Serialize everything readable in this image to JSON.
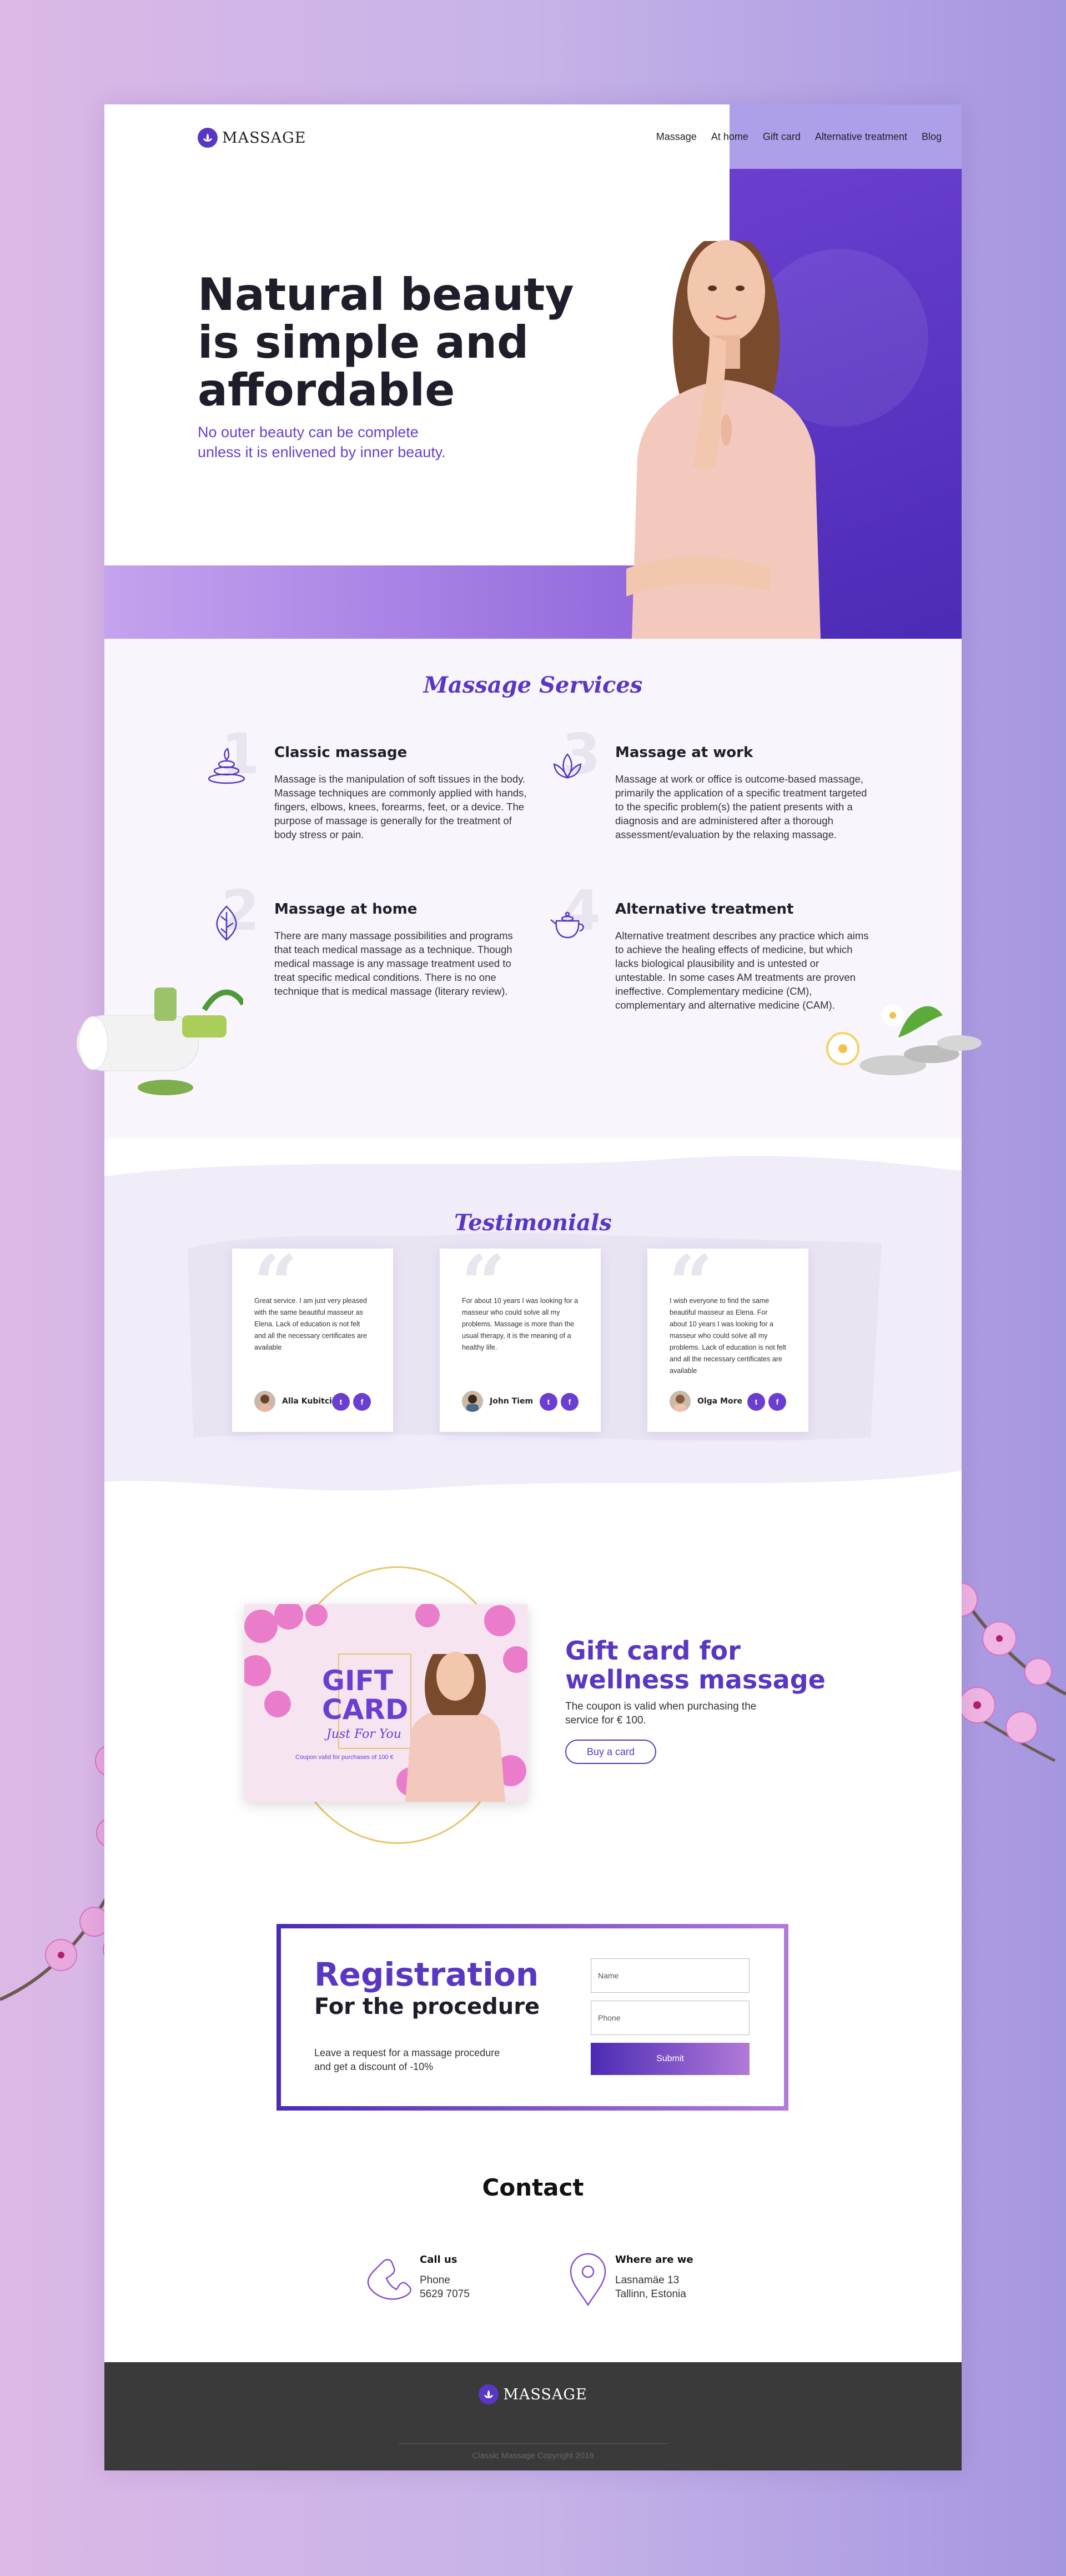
{
  "brand": {
    "name": "MASSAGE"
  },
  "nav": {
    "items": [
      "Massage",
      "At home",
      "Gift card",
      "Alternative treatment",
      "Blog"
    ]
  },
  "hero": {
    "title": "Natural beauty\nis simple and\naffordable",
    "subtitle": "No outer beauty can be complete\nunless it is enlivened by inner beauty."
  },
  "services": {
    "title": "Massage Services",
    "items": [
      {
        "num": "1",
        "title": "Classic massage",
        "text": "Massage is the manipulation of soft tissues in the body. Massage techniques are commonly applied with hands, fingers, elbows, knees, forearms, feet, or a device. The purpose of massage is generally for the treatment of body stress or pain."
      },
      {
        "num": "3",
        "title": "Massage at work",
        "text": "Massage at work or office is outcome-based massage, primarily the application of a specific treatment targeted to the specific problem(s) the patient presents with a diagnosis and are administered after a thorough assessment/evaluation by the relaxing massage."
      },
      {
        "num": "2",
        "title": "Massage at home",
        "text": "There are many massage possibilities and programs that teach medical massage as a technique. Though medical massage is any massage treatment used to treat specific medical conditions. There is no one technique that is medical massage (literary review)."
      },
      {
        "num": "4",
        "title": "Alternative treatment",
        "text": "Alternative treatment describes any practice which aims to achieve the healing effects of medicine, but which lacks biological plausibility and is untested or untestable. In some cases AM treatments are proven ineffective. Complementary medicine (CM), complementary and alternative medicine (CAM)."
      }
    ]
  },
  "testimonials": {
    "title": "Testimonials",
    "items": [
      {
        "text": "Great service. I am just very pleased with the same beautiful masseur as Elena. Lack of education is not felt and all the necessary certificates are available",
        "author": "Alla Kubitci"
      },
      {
        "text": "For about 10 years I was looking for a masseur who could solve all my problems. Massage is more than the usual therapy, it is the meaning of a healthy life.",
        "author": "John Tiem"
      },
      {
        "text": "I wish everyone to find the same beautiful masseur as Elena. For about 10 years I was looking for a masseur who could solve all my problems. Lack of education is not felt and all the necessary certificates are available",
        "author": "Olga More"
      }
    ]
  },
  "gift": {
    "card_line1": "GIFT",
    "card_line2": "CARD",
    "card_line3": "Just For You",
    "card_note": "Coupon valid for purchases of 100 €",
    "title": "Gift card for\nwellness massage",
    "subtitle": "The coupon is valid when purchasing the service for € 100.",
    "button": "Buy a card"
  },
  "registration": {
    "title": "Registration",
    "subtitle": "For the procedure",
    "text": "Leave a request for a massage procedure and get a discount of -10%",
    "name_placeholder": "Name",
    "phone_placeholder": "Phone",
    "submit": "Submit"
  },
  "contact": {
    "title": "Contact",
    "call": {
      "title": "Call us",
      "line1": "Phone",
      "line2": "5629 7075"
    },
    "where": {
      "title": "Where are we",
      "line1": "Lasnamäe 13",
      "line2": "Tallinn, Estonia"
    }
  },
  "footer": {
    "brand": "MASSAGE",
    "copyright": "Classic Massage Copyright 2019"
  },
  "colors": {
    "accent": "#5a37c2",
    "accent_light": "#b27ad8",
    "footer": "#3a3a3a"
  }
}
